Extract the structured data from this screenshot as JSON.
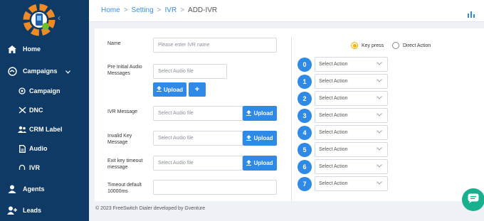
{
  "colors": {
    "sidebar": "#0f3a66",
    "accent": "#2e8ae6",
    "radio_selected": "#f0b400",
    "chat": "#19b08f"
  },
  "sidebar": {
    "items": [
      {
        "label": "Home",
        "icon": "home-icon"
      },
      {
        "label": "Campaigns",
        "icon": "campaigns-icon"
      },
      {
        "label": "Campaign",
        "icon": "campaign-icon"
      },
      {
        "label": "DNC",
        "icon": "dnc-icon"
      },
      {
        "label": "CRM Label",
        "icon": "users-icon"
      },
      {
        "label": "Audio",
        "icon": "file-icon"
      },
      {
        "label": "IVR",
        "icon": "headset-icon"
      },
      {
        "label": "Agents",
        "icon": "user-icon"
      },
      {
        "label": "Leads",
        "icon": "user-plus-icon"
      }
    ]
  },
  "breadcrumb": {
    "home": "Home",
    "setting": "Setting",
    "ivr": "IVR",
    "current": "ADD-IVR",
    "sep": ">"
  },
  "form": {
    "name_label": "Name",
    "name_placeholder": "Please enter IVR name",
    "pre_label_1": "Pre Initial Audio",
    "pre_label_2": "Messages",
    "pre_placeholder": "Select Audio file",
    "upload": "Upload",
    "add": "+",
    "ivr_msg_label": "IVR Message",
    "ivr_msg_placeholder": "Select Audio file",
    "invalid_label_1": "Invalid Key",
    "invalid_label_2": "Message",
    "invalid_placeholder": "Select Audio file",
    "exit_label_1": "Exit key timeout",
    "exit_label_2": "message",
    "exit_placeholder": "Select Audio file",
    "timeout_label_1": "Timeout default",
    "timeout_label_2": "10000ms",
    "timeout_value": ""
  },
  "mode": {
    "key_press": "Key press",
    "direct_action": "Direct Action",
    "selected": "Key press"
  },
  "keys": [
    {
      "key": "0",
      "action": "Select Action"
    },
    {
      "key": "1",
      "action": "Select Action"
    },
    {
      "key": "2",
      "action": "Select Action"
    },
    {
      "key": "3",
      "action": "Select Action"
    },
    {
      "key": "4",
      "action": "Select Action"
    },
    {
      "key": "5",
      "action": "Select Action"
    },
    {
      "key": "6",
      "action": "Select Action"
    },
    {
      "key": "7",
      "action": "Select Action"
    },
    {
      "key": "",
      "action": ""
    }
  ],
  "footer": "© 2023 FreeSwitch Dialer developed by Gventure"
}
